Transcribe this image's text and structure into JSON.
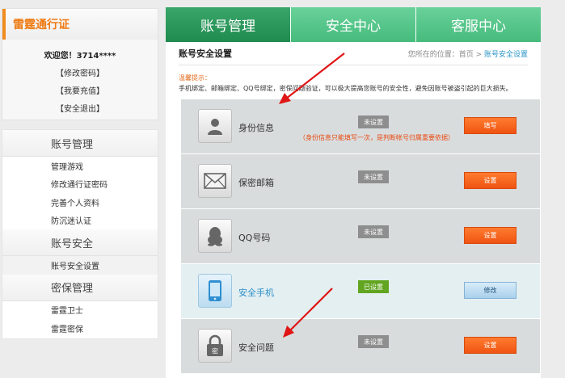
{
  "passport": {
    "title": "雷霆通行证",
    "welcome": "欢迎您！3714****",
    "links": [
      "【修改密码】",
      "【我要充值】",
      "【安全退出】"
    ]
  },
  "sidebar": {
    "sections": [
      {
        "title": "账号管理",
        "items": [
          "管理游戏",
          "修改通行证密码",
          "完善个人资料",
          "防沉迷认证"
        ]
      },
      {
        "title": "账号安全",
        "items": [
          "账号安全设置"
        ]
      },
      {
        "title": "密保管理",
        "items": [
          "雷霆卫士",
          "雷霆密保"
        ]
      }
    ],
    "active_item": "账号安全设置"
  },
  "tabs": [
    "账号管理",
    "安全中心",
    "客服中心"
  ],
  "page": {
    "title": "账号安全设置",
    "breadcrumb_prefix": "您所在的位置：首页 >",
    "breadcrumb_current": "账号安全设置",
    "tip_label": "温馨提示：",
    "tip_text": "手机绑定、邮箱绑定、QQ号绑定，密保问题验证，可以极大提高您账号的安全性，避免因账号被盗引起的巨大损失。"
  },
  "rows": [
    {
      "label": "身份信息",
      "status": "未设置",
      "button": "填写",
      "note": "（身份信息只能填写一次，是判断帐号归属重要依据）",
      "icon": "person-icon"
    },
    {
      "label": "保密邮箱",
      "status": "未设置",
      "button": "设置",
      "icon": "mail-icon"
    },
    {
      "label": "QQ号码",
      "status": "未设置",
      "button": "设置",
      "icon": "qq-penguin-icon"
    },
    {
      "label": "安全手机",
      "status": "已设置",
      "button": "修改",
      "icon": "phone-icon"
    },
    {
      "label": "安全问题",
      "status": "未设置",
      "button": "设置",
      "icon": "padlock-icon",
      "icon_text": "密"
    }
  ],
  "colors": {
    "accent_orange": "#ef7a12",
    "tab_active": "#1f8b4f",
    "tab_inactive": "#46bb7c",
    "action_button": "#ef5412",
    "status_set": "#62a521",
    "annotation_arrow": "#e01515"
  }
}
